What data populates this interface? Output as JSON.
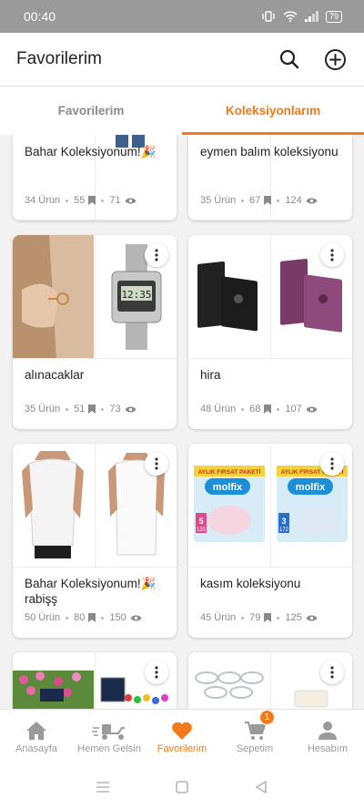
{
  "status": {
    "time": "00:40",
    "battery": "79"
  },
  "appbar": {
    "title": "Favorilerim"
  },
  "tabs": [
    {
      "label": "Favorilerim"
    },
    {
      "label": "Koleksiyonlarım"
    }
  ],
  "collections": [
    {
      "name": "Bahar Koleksiyonum!🎉",
      "products": "34 Ürün",
      "saves": "55",
      "views": "71"
    },
    {
      "name": "eymen balım koleksiyonu",
      "products": "35 Ürün",
      "saves": "67",
      "views": "124"
    },
    {
      "name": "alınacaklar",
      "products": "35 Ürün",
      "saves": "51",
      "views": "73"
    },
    {
      "name": "hira",
      "products": "48 Ürün",
      "saves": "68",
      "views": "107"
    },
    {
      "name": "Bahar Koleksiyonum!🎉 rabişş",
      "products": "50 Ürün",
      "saves": "80",
      "views": "150"
    },
    {
      "name": "kasım koleksiyonu",
      "products": "45 Ürün",
      "saves": "79",
      "views": "125"
    }
  ],
  "product_images": {
    "molfix_banner": "AYLIK FIRSAT PAKETİ",
    "molfix_brand": "molfix",
    "molfix_size_1": "5",
    "molfix_count_1": "120",
    "molfix_size_2": "3",
    "molfix_count_2": "172"
  },
  "bottomnav": {
    "items": [
      {
        "label": "Anasayfa",
        "icon": "home-icon"
      },
      {
        "label": "Hemen Gelsin",
        "icon": "scooter-icon"
      },
      {
        "label": "Favorilerim",
        "icon": "heart-icon"
      },
      {
        "label": "Sepetim",
        "icon": "cart-icon"
      },
      {
        "label": "Hesabım",
        "icon": "user-icon"
      }
    ],
    "cart_badge": "1"
  },
  "colors": {
    "accent": "#f27a1a",
    "statusbar": "#9a9a9a",
    "background": "#f2f2f2"
  }
}
